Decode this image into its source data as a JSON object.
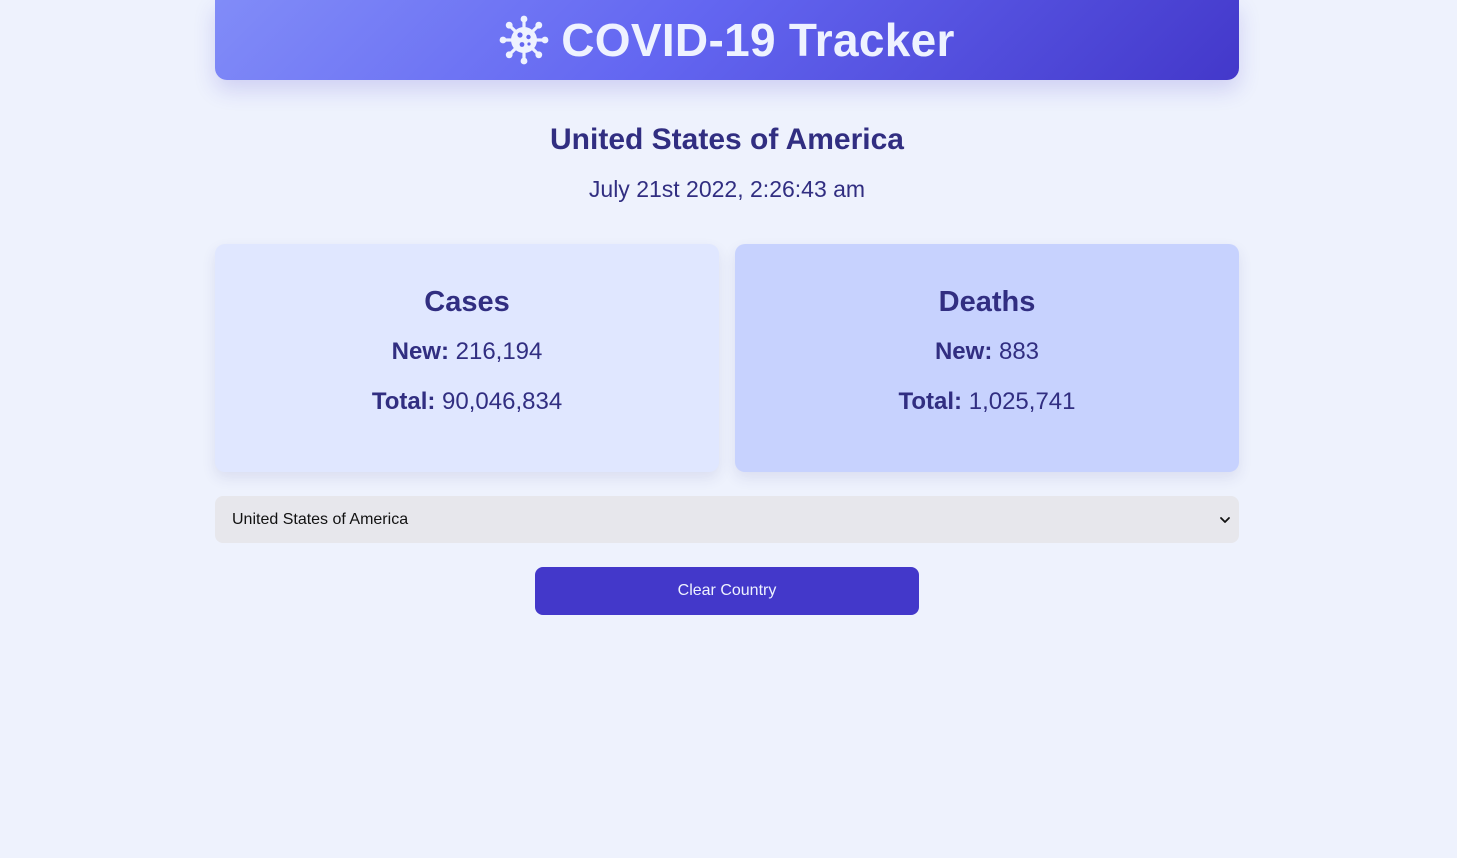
{
  "header": {
    "title": "COVID-19 Tracker",
    "icon": "virus-icon"
  },
  "country": {
    "name": "United States of America",
    "date": "July 21st 2022, 2:26:43 am"
  },
  "cards": {
    "cases": {
      "heading": "Cases",
      "new_label": "New:",
      "new_value": "216,194",
      "total_label": "Total:",
      "total_value": "90,046,834"
    },
    "deaths": {
      "heading": "Deaths",
      "new_label": "New:",
      "new_value": "883",
      "total_label": "Total:",
      "total_value": "1,025,741"
    }
  },
  "country_select": {
    "selected": "United States of America"
  },
  "clear_button": {
    "label": "Clear Country"
  },
  "colors": {
    "background": "#eef2fd",
    "text": "#312e81",
    "accent": "#4338ca",
    "cases_card": "#e0e7ff",
    "deaths_card": "#c7d2fe"
  }
}
